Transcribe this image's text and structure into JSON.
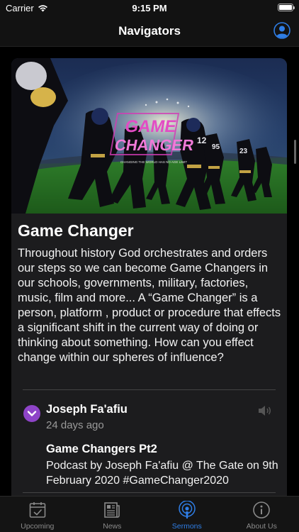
{
  "status_bar": {
    "carrier": "Carrier",
    "time": "9:15 PM"
  },
  "nav": {
    "title": "Navigators"
  },
  "card": {
    "title": "Game Changer",
    "description": "Throughout history God orchestrates and orders our steps so we can become Game Changers in our schools, governments, military, factories, music, film and more...  A “Game Changer” is a person, platform , product or procedure that effects a significant shift in the current way of doing or thinking about something.  How can you effect change within our spheres of influence?",
    "hero_text": {
      "line1": "GAME",
      "line2": "CHANGER",
      "tagline": "CHANGING THE WORLD HAS NO AGE LIMIT"
    }
  },
  "episode": {
    "author": "Joseph Fa'afiu",
    "age": "24 days ago",
    "title": "Game Changers Pt2",
    "description": "Podcast by Joseph Fa'afiu @ The Gate on 9th February 2020 #GameChanger2020"
  },
  "tabs": [
    {
      "label": "Upcoming",
      "icon": "calendar-icon"
    },
    {
      "label": "News",
      "icon": "newspaper-icon"
    },
    {
      "label": "Sermons",
      "icon": "podcast-icon",
      "active": true
    },
    {
      "label": "About Us",
      "icon": "info-icon"
    }
  ],
  "colors": {
    "accent": "#2f7ee6",
    "check": "#8e44c8",
    "card_bg": "#1c1c1e"
  }
}
